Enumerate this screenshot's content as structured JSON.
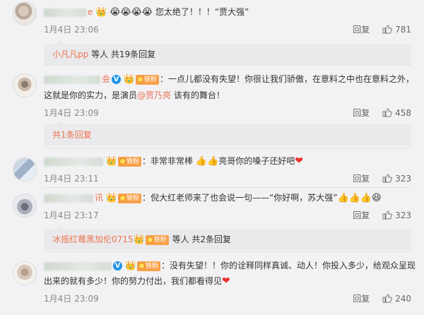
{
  "comments": [
    {
      "name_tail": "e",
      "text_emojis": "😭😭😭😭",
      "text": "您太绝了！！！“贾大强”",
      "time": "1月4日 23:06",
      "reply_label": "回复",
      "likes": "781"
    },
    {
      "name_tail": "会",
      "fan_badge": "铁粉",
      "text_line1": "：一点儿都没有失望！你很让我们骄傲，在意料之中也在意料之外，",
      "text_line2a": "这就是你的实力，是演员",
      "mention": "@贾乃亮",
      "text_line2b": " 该有的舞台！",
      "time": "1月4日 23:09",
      "reply_label": "回复",
      "likes": "458"
    },
    {
      "fan_badge": "铁粉",
      "text_a": "：非常非常棒 ",
      "text_emojis": "👍👍",
      "text_b": "亮哥你的嗓子还好吧",
      "heart": "❤",
      "time": "1月4日 23:11",
      "reply_label": "回复",
      "likes": "323"
    },
    {
      "name_tail": "讯",
      "fan_badge": "铁粉",
      "text": "：倪大红老师来了也会说一句——“你好啊，苏大强”",
      "text_emojis": "👍👍👍😆",
      "time": "1月4日 23:17",
      "reply_label": "回复",
      "likes": "323"
    },
    {
      "fan_badge": "铁粉",
      "text_line1": "：没有失望！！你的诠释同样真诚、动人！你投入多少，给观众呈现",
      "text_line2": "出来的就有多少！你的努力付出，我们都看得见",
      "heart": "❤",
      "time": "1月4日 23:09",
      "reply_label": "回复",
      "likes": "240"
    }
  ],
  "replies": [
    {
      "user": "小凡凡pp",
      "rest": " 等人 共19条回复"
    },
    {
      "text": "共1条回复"
    },
    {
      "user": "冰摇红莓黑加伦0715",
      "badge": "铁粉",
      "rest": " 等人 共2条回复"
    }
  ]
}
